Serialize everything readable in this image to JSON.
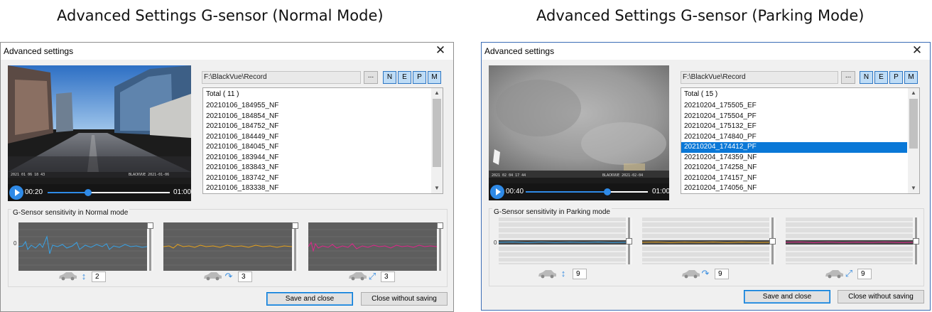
{
  "captions": {
    "left": "Advanced Settings G-sensor (Normal Mode)",
    "right": "Advanced Settings G-sensor (Parking Mode)"
  },
  "icons": {
    "close": "close-icon",
    "play": "play-icon",
    "car": "car-icon",
    "vertical": "vertical-arrows-icon",
    "curved": "curved-arrow-icon",
    "diagonal": "diagonal-arrows-icon"
  },
  "colors": {
    "accent": "#2f8ae6",
    "selection": "#0a78d7",
    "series_x": "#37a3e8",
    "series_y": "#e6a21c",
    "series_z": "#e0268c"
  },
  "dialogs": [
    {
      "title": "Advanced settings",
      "close_glyph": "✕",
      "video": {
        "time_current": "00:20",
        "time_end": "01:00",
        "progress": 0.33
      },
      "path": "F:\\BlackVue\\Record",
      "browse_label": "...",
      "filters": [
        "N",
        "E",
        "P",
        "M"
      ],
      "list_total": "Total ( 11 )",
      "files": [
        "20210106_184955_NF",
        "20210106_184854_NF",
        "20210106_184752_NF",
        "20210106_184449_NF",
        "20210106_184045_NF",
        "20210106_183944_NF",
        "20210106_183843_NF",
        "20210106_183742_NF",
        "20210106_183338_NF"
      ],
      "selected_index": -1,
      "sensor_group_label": "G-Sensor sensitivity in Normal mode",
      "zero_label": "0",
      "axes": [
        {
          "axis": "vertical",
          "value": "2",
          "slider_level": 0.0
        },
        {
          "axis": "curved",
          "value": "3",
          "slider_level": 0.0
        },
        {
          "axis": "diagonal",
          "value": "3",
          "slider_level": 0.0
        }
      ],
      "save_label": "Save and close",
      "close_label": "Close without saving"
    },
    {
      "title": "Advanced settings",
      "close_glyph": "✕",
      "video": {
        "time_current": "00:40",
        "time_end": "01:00",
        "progress": 0.67
      },
      "path": "F:\\BlackVue\\Record",
      "browse_label": "...",
      "filters": [
        "N",
        "E",
        "P",
        "M"
      ],
      "list_total": "Total ( 15 )",
      "files": [
        "20210204_175505_EF",
        "20210204_175504_PF",
        "20210204_175132_EF",
        "20210204_174840_PF",
        "20210204_174412_PF",
        "20210204_174359_NF",
        "20210204_174258_NF",
        "20210204_174157_NF",
        "20210204_174056_NF"
      ],
      "selected_index": 4,
      "sensor_group_label": "G-Sensor sensitivity in Parking mode",
      "zero_label": "0",
      "axes": [
        {
          "axis": "vertical",
          "value": "9",
          "slider_level": 0.5
        },
        {
          "axis": "curved",
          "value": "9",
          "slider_level": 0.5
        },
        {
          "axis": "diagonal",
          "value": "9",
          "slider_level": 0.5
        }
      ],
      "save_label": "Save and close",
      "close_label": "Close without saving"
    }
  ]
}
